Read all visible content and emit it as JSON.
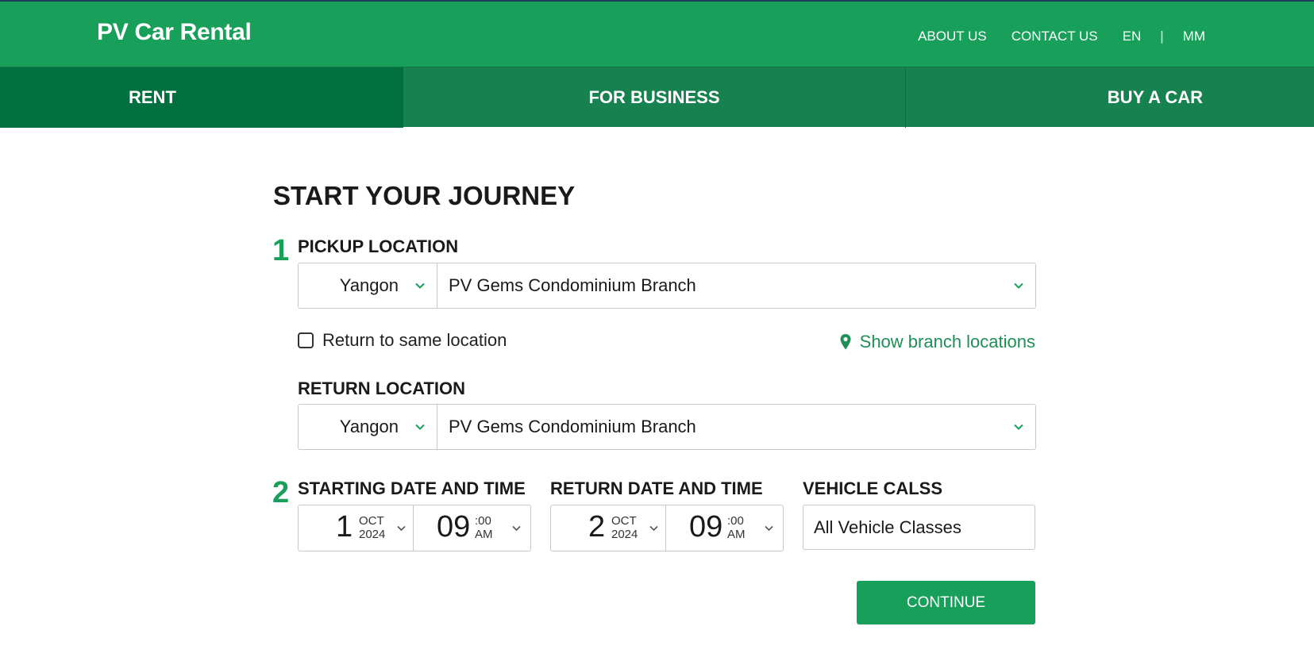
{
  "header": {
    "brand": "PV Car Rental",
    "links": [
      "ABOUT US",
      "CONTACT US",
      "EN",
      "|",
      "MM"
    ]
  },
  "tabs": [
    "RENT",
    "FOR BUSINESS",
    "BUY A CAR"
  ],
  "form": {
    "title": "START YOUR JOURNEY",
    "step1": "1",
    "step2": "2",
    "pickup": {
      "label": "PICKUP LOCATION",
      "city": "Yangon",
      "branch": "PV Gems Condominium Branch"
    },
    "return_same": "Return to same location",
    "show_branches": "Show branch locations",
    "return": {
      "label": "RETURN LOCATION",
      "city": "Yangon",
      "branch": "PV Gems Condominium Branch"
    },
    "start": {
      "label": "STARTING DATE AND TIME",
      "day": "1",
      "month": "OCT",
      "year": "2024",
      "hour": "09",
      "minute": ":00",
      "ampm": "AM"
    },
    "end": {
      "label": "RETURN DATE AND TIME",
      "day": "2",
      "month": "OCT",
      "year": "2024",
      "hour": "09",
      "minute": ":00",
      "ampm": "AM"
    },
    "vehicle": {
      "label": "VEHICLE CALSS",
      "value": "All Vehicle Classes"
    },
    "continue": "CONTINUE"
  },
  "colors": {
    "primary_green": "#18a05a",
    "active_tab": "#007040",
    "tab_bar": "#178250",
    "link_green": "#1f8f57"
  }
}
